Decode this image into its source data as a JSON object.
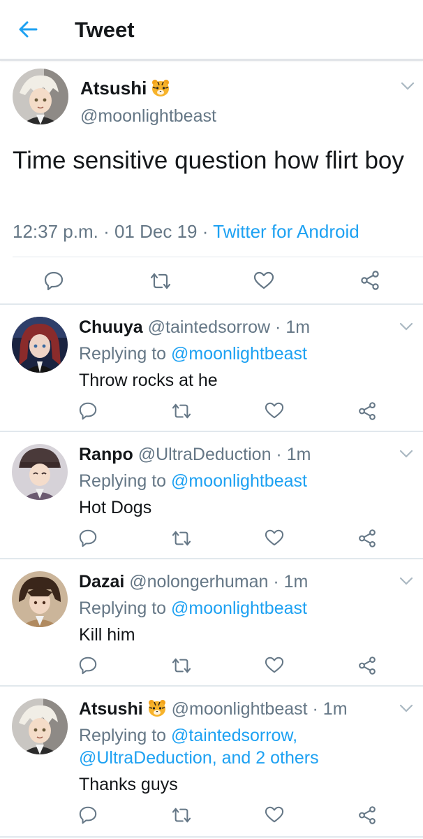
{
  "header": {
    "title": "Tweet"
  },
  "main_tweet": {
    "name": "Atsushi",
    "handle": "@moonlightbeast",
    "text": "Time sensitive question how flirt boy",
    "time": "12:37 p.m.",
    "dot1": " · ",
    "date": "01 Dec 19",
    "dot2": " · ",
    "source": "Twitter for Android"
  },
  "replies": [
    {
      "name": "Chuuya",
      "handle": "@taintedsorrow",
      "time": "1m",
      "replying_prefix": "Replying to ",
      "replying_line1": "@moonlightbeast",
      "replying_line2": "",
      "text": "Throw rocks at he"
    },
    {
      "name": "Ranpo",
      "handle": "@UltraDeduction",
      "time": "1m",
      "replying_prefix": "Replying to ",
      "replying_line1": "@moonlightbeast",
      "replying_line2": "",
      "text": "Hot Dogs"
    },
    {
      "name": "Dazai",
      "handle": "@nolongerhuman",
      "time": "1m",
      "replying_prefix": "Replying to ",
      "replying_line1": "@moonlightbeast",
      "replying_line2": "",
      "text": "Kill him"
    },
    {
      "name": "Atsushi",
      "handle": "@moonlightbeast",
      "time": "1m",
      "replying_prefix": "Replying to ",
      "replying_line1": "@taintedsorrow,",
      "replying_line2": "@UltraDeduction, and 2 others",
      "text": "Thanks guys"
    }
  ],
  "separator": " · ",
  "icons": {
    "back": "arrow-left-icon",
    "reply": "reply-icon",
    "retweet": "retweet-icon",
    "like": "heart-icon",
    "share": "share-icon",
    "more": "chevron-down-icon",
    "emoji": "tiger-emoji"
  },
  "colors": {
    "accent": "#1da1f2",
    "secondary": "#657786",
    "text": "#14171a",
    "divider": "#e1e8ed"
  }
}
